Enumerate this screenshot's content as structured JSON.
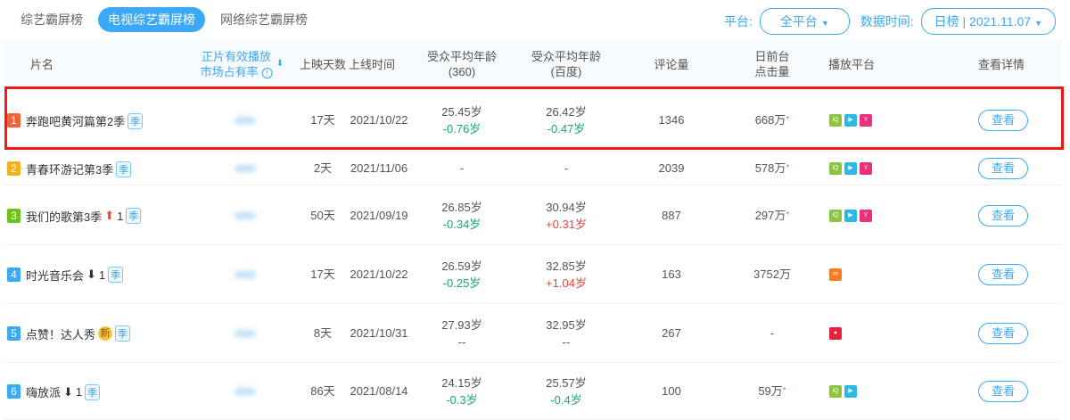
{
  "tabs": [
    "综艺霸屏榜",
    "电视综艺霸屏榜",
    "网络综艺霸屏榜"
  ],
  "filters": {
    "platform_label": "平台:",
    "platform_value": "全平台",
    "time_label": "数据时间:",
    "time_value": "日榜 | 2021.11.07"
  },
  "headers": {
    "name": "片名",
    "share_1": "正片有效播放",
    "share_2": "市场占有率",
    "days": "上映天数",
    "date": "上线时间",
    "age360_1": "受众平均年龄",
    "age360_2": "(360)",
    "agebd_1": "受众平均年龄",
    "agebd_2": "(百度)",
    "comments": "评论量",
    "clicks_1": "日前台",
    "clicks_2": "点击量",
    "platform": "播放平台",
    "details": "查看详情"
  },
  "colors": {
    "accent": "#3ba9f5",
    "highlight": "#f01a12"
  },
  "rows": [
    {
      "rank": "1",
      "rank_color": "#f0643a",
      "name": "奔跑吧黄河篇第2季",
      "tag": "季",
      "days": "17天",
      "date": "2021/10/22",
      "age360": "25.45岁",
      "age360_d": "-0.76岁",
      "agebd": "26.42岁",
      "agebd_d": "-0.47岁",
      "comments": "1346",
      "clicks": "668万",
      "star": "*",
      "platforms": [
        "iqiyi",
        "tencent",
        "youku"
      ],
      "view": "查看"
    },
    {
      "rank": "2",
      "rank_color": "#f5b021",
      "name": "青春环游记第3季",
      "tag": "季",
      "days": "2天",
      "date": "2021/11/06",
      "age360": "-",
      "agebd": "-",
      "comments": "2039",
      "clicks": "578万",
      "star": "*",
      "platforms": [
        "iqiyi",
        "tencent",
        "youku"
      ],
      "view": "查看"
    },
    {
      "rank": "3",
      "rank_color": "#6cc31c",
      "name": "我们的歌第3季",
      "trend": "up",
      "trend_n": "1",
      "tag": "季",
      "days": "50天",
      "date": "2021/09/19",
      "age360": "26.85岁",
      "age360_d": "-0.34岁",
      "agebd": "30.94岁",
      "agebd_d": "+0.31岁",
      "comments": "887",
      "clicks": "297万",
      "star": "*",
      "platforms": [
        "iqiyi",
        "tencent",
        "youku"
      ],
      "view": "查看"
    },
    {
      "rank": "4",
      "rank_color": "#3ba9f5",
      "name": "时光音乐会",
      "trend": "down",
      "trend_n": "1",
      "tag": "季",
      "days": "17天",
      "date": "2021/10/22",
      "age360": "26.59岁",
      "age360_d": "-0.25岁",
      "agebd": "32.85岁",
      "agebd_d": "+1.04岁",
      "comments": "163",
      "clicks": "3752万",
      "platforms": [
        "mango"
      ],
      "view": "查看"
    },
    {
      "rank": "5",
      "rank_color": "#3ba9f5",
      "name": "点赞！达人秀",
      "new": "新",
      "tag": "季",
      "days": "8天",
      "date": "2021/10/31",
      "age360": "27.93岁",
      "age360_d": "--",
      "agebd": "32.95岁",
      "agebd_d": "--",
      "comments": "267",
      "clicks": "-",
      "platforms": [
        "other"
      ],
      "view": "查看"
    },
    {
      "rank": "6",
      "rank_color": "#3ba9f5",
      "name": "嗨放派",
      "trend": "down",
      "trend_n": "1",
      "tag": "季",
      "days": "86天",
      "date": "2021/08/14",
      "age360": "24.15岁",
      "age360_d": "-0.3岁",
      "agebd": "25.57岁",
      "agebd_d": "-0.4岁",
      "comments": "100",
      "clicks": "59万",
      "star": "*",
      "platforms": [
        "iqiyi",
        "tencent"
      ],
      "view": "查看"
    }
  ]
}
